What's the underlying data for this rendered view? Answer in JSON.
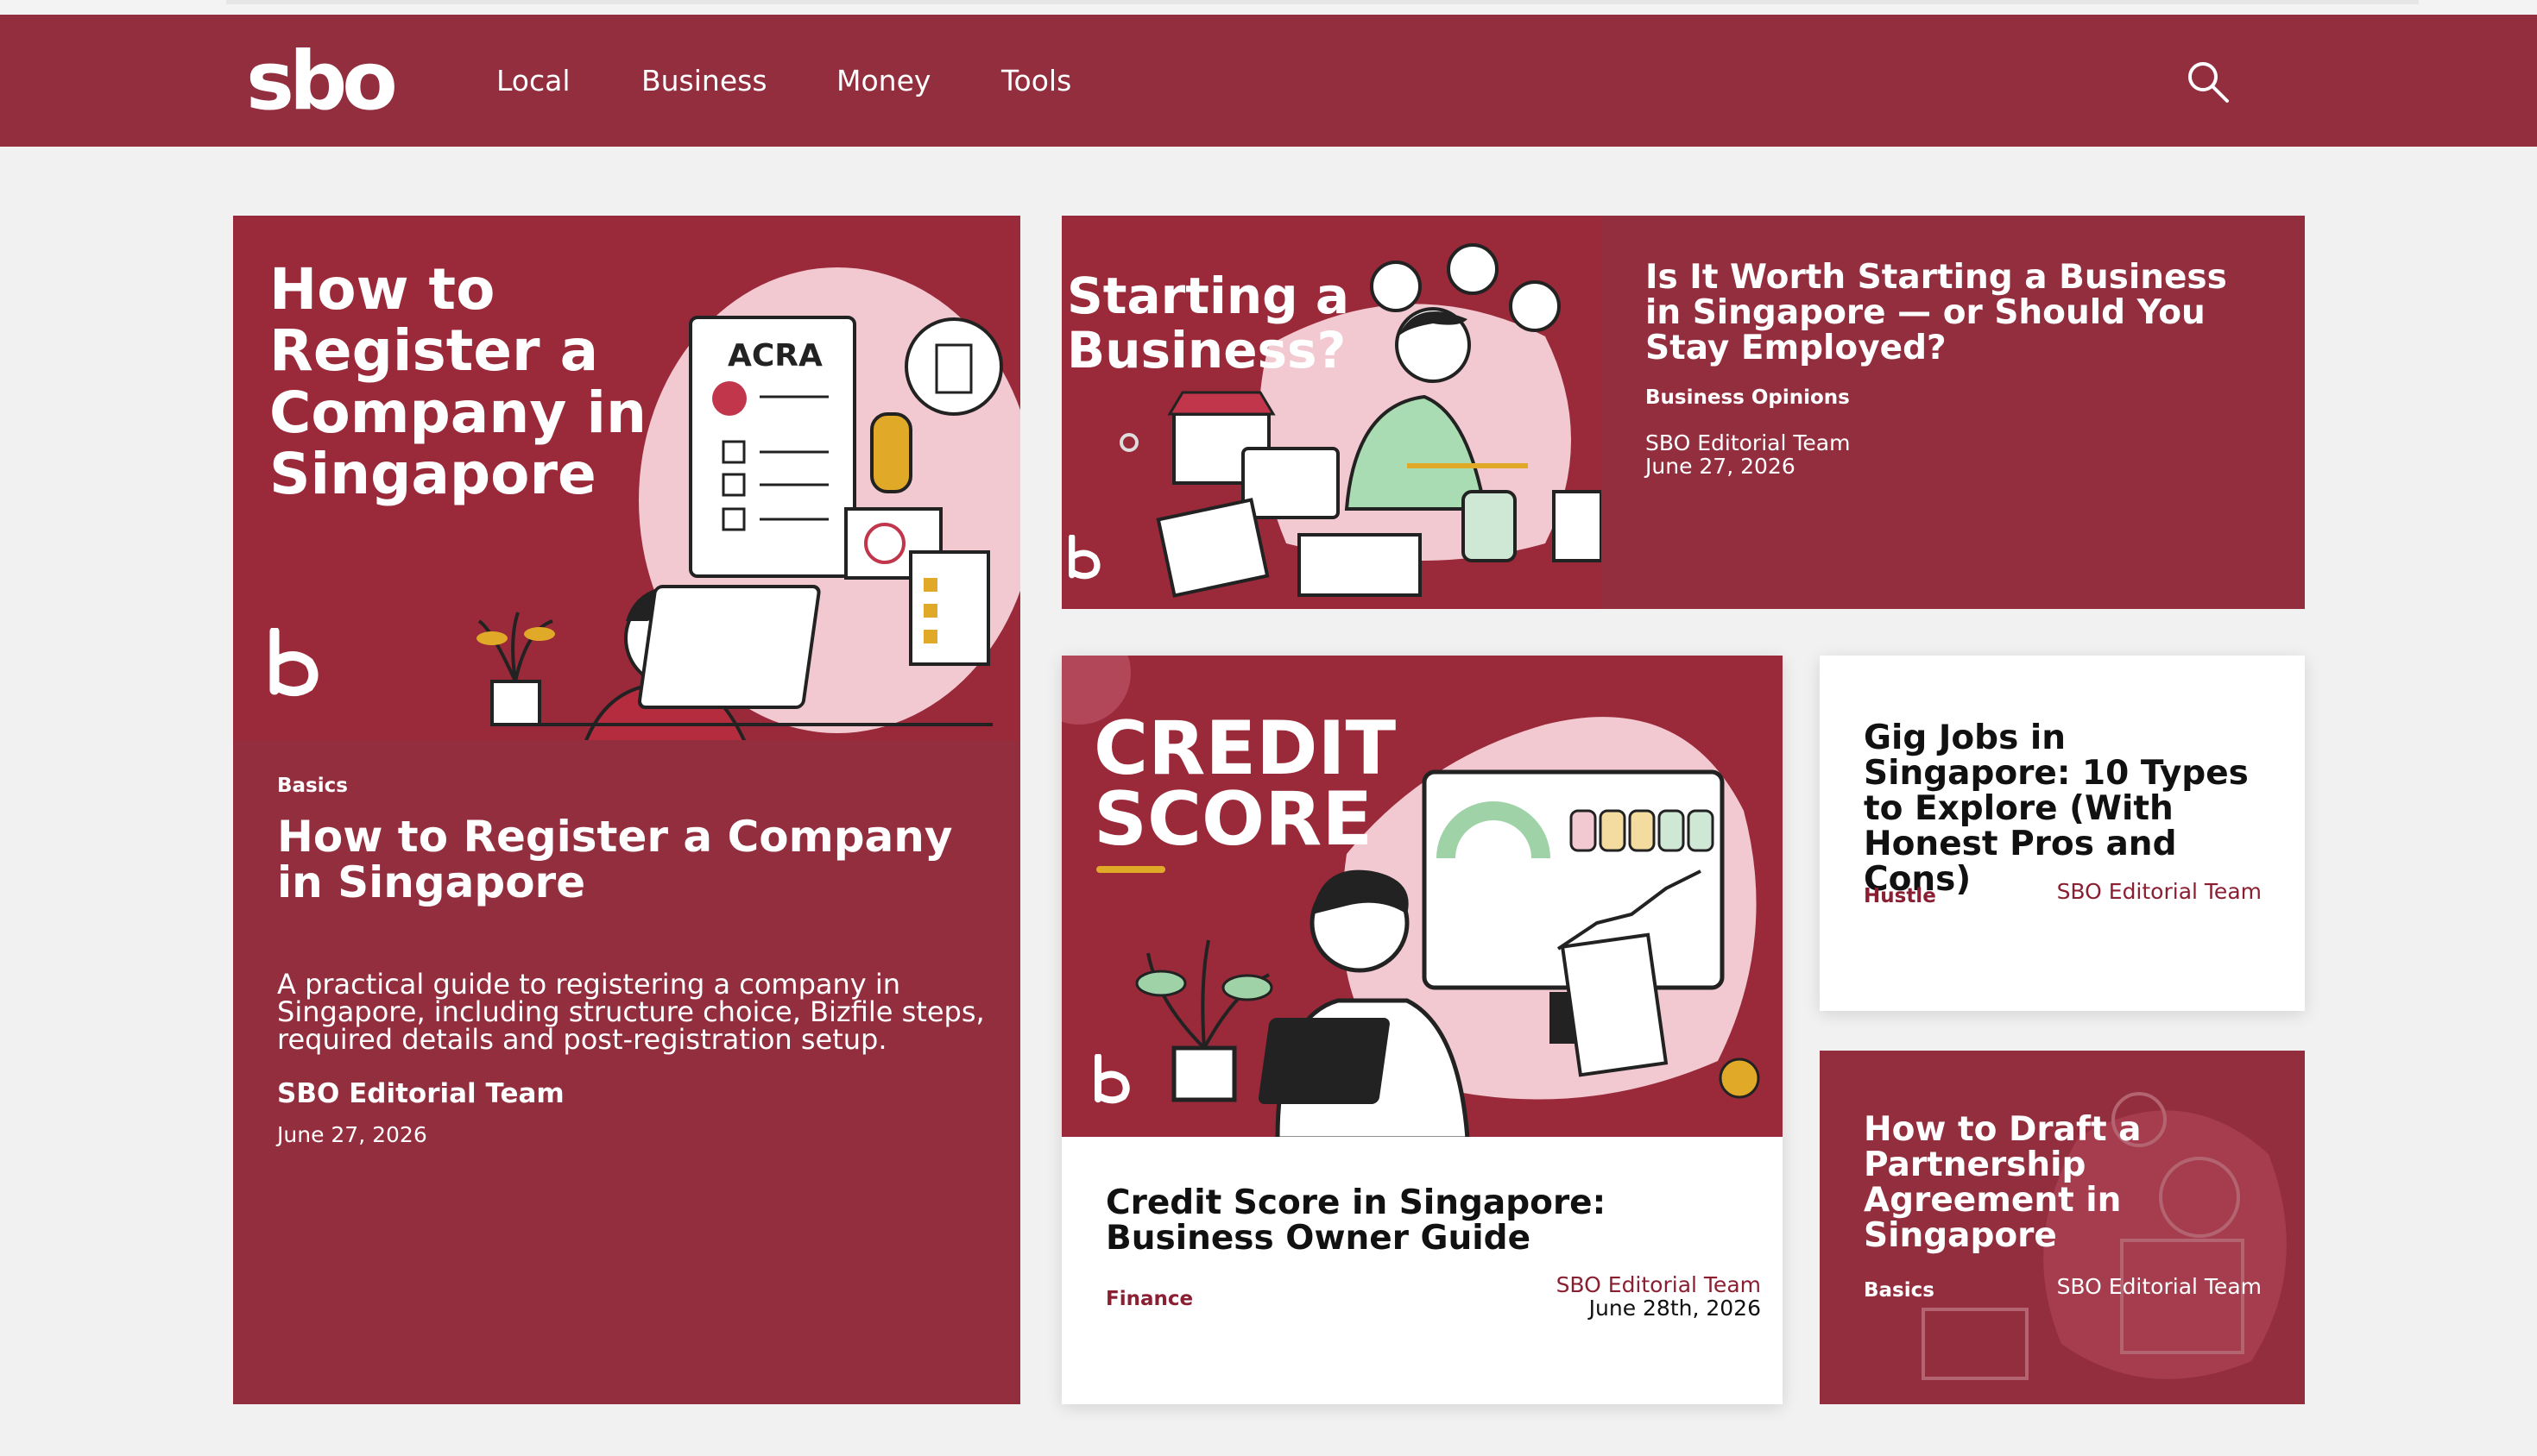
{
  "site": {
    "logo": "sbo"
  },
  "nav": {
    "items": [
      "Local",
      "Business",
      "Money",
      "Tools"
    ]
  },
  "icons": {
    "search": "search-icon",
    "brand_mark": "b-logo-icon"
  },
  "colors": {
    "brand": "#932e3e",
    "accent_text": "#8a1f32",
    "page_bg": "#f1f1f1"
  },
  "featured": {
    "image_title": "How to\nRegister a\nCompany in\nSingapore",
    "image_labels": {
      "acra": "ACRA"
    },
    "category": "Basics",
    "title": "How to Register a Company in Singapore",
    "excerpt": "A practical guide to registering a company in Singapore, including structure choice, Bizfile steps, required details and post-registration setup.",
    "author": "SBO Editorial Team",
    "date": "June 27, 2026"
  },
  "wide_card": {
    "image_title": "Starting a\nBusiness?",
    "title": "Is It Worth Starting a Business in Singapore — or Should You Stay Employed?",
    "category": "Business Opinions",
    "author": "SBO Editorial Team",
    "date": "June 27, 2026"
  },
  "credit_card": {
    "image_title": "CREDIT\nSCORE",
    "title": "Credit Score in Singapore: Business Owner Guide",
    "category": "Finance",
    "author": "SBO Editorial Team",
    "date": "June 28th, 2026"
  },
  "gig_card": {
    "title": "Gig Jobs in Singapore: 10 Types to Explore (With Honest Pros and Cons)",
    "category": "Hustle",
    "author": "SBO Editorial Team"
  },
  "partnership_card": {
    "title": "How to Draft a Partnership Agreement in Singapore",
    "category": "Basics",
    "author": "SBO Editorial Team"
  }
}
